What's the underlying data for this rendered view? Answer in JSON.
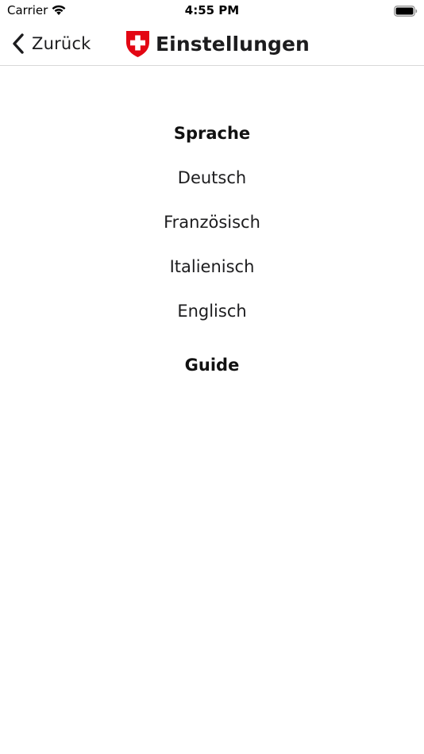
{
  "status_bar": {
    "carrier": "Carrier",
    "time": "4:55 PM",
    "wifi_icon": "wifi-icon",
    "battery_icon": "battery-icon"
  },
  "nav": {
    "back_label": "Zurück",
    "back_icon": "chevron-left-icon",
    "logo_icon": "swiss-coat-of-arms-icon",
    "title": "Einstellungen"
  },
  "sections": {
    "language": {
      "header": "Sprache",
      "options": [
        "Deutsch",
        "Französisch",
        "Italienisch",
        "Englisch"
      ]
    },
    "guide": {
      "label": "Guide"
    }
  },
  "colors": {
    "accent_red": "#e30613",
    "text": "#1c1c1e",
    "divider": "#d8d8d8"
  }
}
